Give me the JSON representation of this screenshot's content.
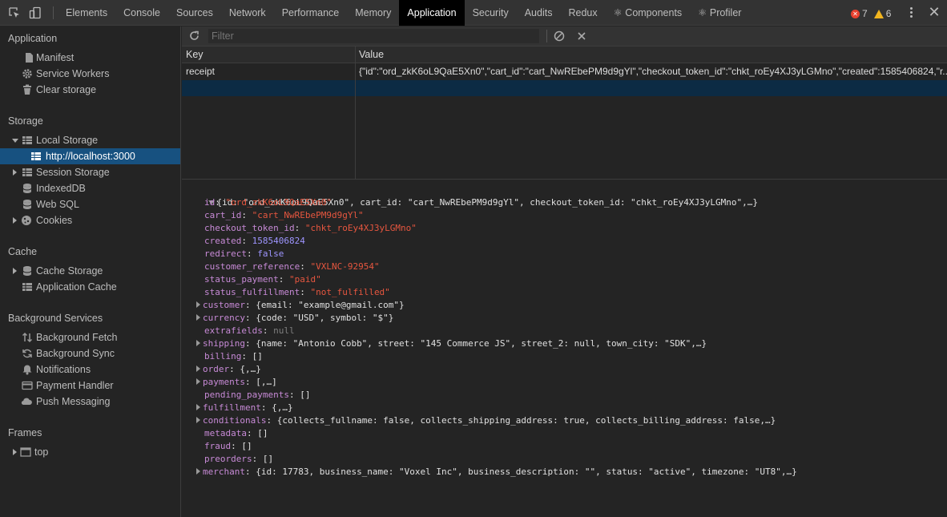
{
  "devtools": {
    "tabs": [
      {
        "label": "Elements"
      },
      {
        "label": "Console"
      },
      {
        "label": "Sources"
      },
      {
        "label": "Network"
      },
      {
        "label": "Performance"
      },
      {
        "label": "Memory"
      },
      {
        "label": "Application",
        "active": true
      },
      {
        "label": "Security"
      },
      {
        "label": "Audits"
      },
      {
        "label": "Redux"
      },
      {
        "label": "⚛ Components"
      },
      {
        "label": "⚛ Profiler"
      }
    ],
    "error_count": "7",
    "warning_count": "6",
    "error_color": "#e8412e",
    "warning_color": "#f2b51f",
    "active_tab_bg": "#000000"
  },
  "sidebar": {
    "application": {
      "title": "Application",
      "items": [
        {
          "label": "Manifest",
          "icon": "document-icon"
        },
        {
          "label": "Service Workers",
          "icon": "gear-icon"
        },
        {
          "label": "Clear storage",
          "icon": "trash-icon"
        }
      ]
    },
    "storage": {
      "title": "Storage",
      "local_storage": "Local Storage",
      "localhost": "http://localhost:3000",
      "items": [
        {
          "label": "Session Storage",
          "icon": "grid-icon"
        },
        {
          "label": "IndexedDB",
          "icon": "database-icon"
        },
        {
          "label": "Web SQL",
          "icon": "database-icon"
        },
        {
          "label": "Cookies",
          "icon": "cookie-icon"
        }
      ]
    },
    "cache": {
      "title": "Cache",
      "items": [
        {
          "label": "Cache Storage",
          "icon": "database-icon"
        },
        {
          "label": "Application Cache",
          "icon": "grid-icon"
        }
      ]
    },
    "background": {
      "title": "Background Services",
      "items": [
        {
          "label": "Background Fetch",
          "icon": "arrows-icon"
        },
        {
          "label": "Background Sync",
          "icon": "sync-icon"
        },
        {
          "label": "Notifications",
          "icon": "bell-icon"
        },
        {
          "label": "Payment Handler",
          "icon": "card-icon"
        },
        {
          "label": "Push Messaging",
          "icon": "cloud-icon"
        }
      ]
    },
    "frames": {
      "title": "Frames",
      "top": "top"
    },
    "selected_color": "#175180"
  },
  "toolbar": {
    "filter_placeholder": "Filter"
  },
  "table": {
    "headers": {
      "key": "Key",
      "value": "Value"
    },
    "rows": [
      {
        "key": "receipt",
        "value": "{\"id\":\"ord_zkK6oL9QaE5Xn0\",\"cart_id\":\"cart_NwREbePM9d9gYl\",\"checkout_token_id\":\"chkt_roEy4XJ3yLGMno\",\"created\":1585406824,\"r..."
      }
    ]
  },
  "inspector": {
    "summary": "{id: \"ord_zkK6oL9QaE5Xn0\", cart_id: \"cart_NwREbePM9d9gYl\", checkout_token_id: \"chkt_roEy4XJ3yLGMno\",…}",
    "props": [
      {
        "key": "id",
        "value": "\"ord_zkK6oL9QaE5Xn0\"",
        "type": "string"
      },
      {
        "key": "cart_id",
        "value": "\"cart_NwREbePM9d9gYl\"",
        "type": "string"
      },
      {
        "key": "checkout_token_id",
        "value": "\"chkt_roEy4XJ3yLGMno\"",
        "type": "string"
      },
      {
        "key": "created",
        "value": "1585406824",
        "type": "number"
      },
      {
        "key": "redirect",
        "value": "false",
        "type": "keyword"
      },
      {
        "key": "customer_reference",
        "value": "\"VXLNC-92954\"",
        "type": "string"
      },
      {
        "key": "status_payment",
        "value": "\"paid\"",
        "type": "string"
      },
      {
        "key": "status_fulfillment",
        "value": "\"not_fulfilled\"",
        "type": "string"
      },
      {
        "key": "customer",
        "value": "{email: \"example@gmail.com\"}",
        "type": "object"
      },
      {
        "key": "currency",
        "value": "{code: \"USD\", symbol: \"$\"}",
        "type": "object"
      },
      {
        "key": "extrafields",
        "value": "null",
        "type": "null"
      },
      {
        "key": "shipping",
        "value": "{name: \"Antonio Cobb\", street: \"145 Commerce JS\", street_2: null, town_city: \"SDK\",…}",
        "type": "object"
      },
      {
        "key": "billing",
        "value": "[]",
        "type": "plain"
      },
      {
        "key": "order",
        "value": "{,…}",
        "type": "object"
      },
      {
        "key": "payments",
        "value": "[,…]",
        "type": "object"
      },
      {
        "key": "pending_payments",
        "value": "[]",
        "type": "plain"
      },
      {
        "key": "fulfillment",
        "value": "{,…}",
        "type": "object"
      },
      {
        "key": "conditionals",
        "value": "{collects_fullname: false, collects_shipping_address: true, collects_billing_address: false,…}",
        "type": "object"
      },
      {
        "key": "metadata",
        "value": "[]",
        "type": "plain"
      },
      {
        "key": "fraud",
        "value": "[]",
        "type": "plain"
      },
      {
        "key": "preorders",
        "value": "[]",
        "type": "plain"
      },
      {
        "key": "merchant",
        "value": "{id: 17783, business_name: \"Voxel Inc\", business_description: \"\", status: \"active\", timezone: \"UT8\",…}",
        "type": "object"
      }
    ]
  }
}
